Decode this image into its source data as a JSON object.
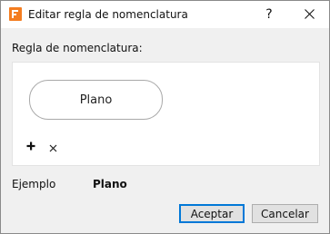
{
  "window": {
    "title": "Editar regla de nomenclatura",
    "help_label": "?",
    "app_icon": "F-app-icon",
    "icons": {
      "app": "F-app-icon",
      "close": "close-icon",
      "add": "plus-icon",
      "remove": "x-icon"
    },
    "colors": {
      "app_icon": "#f47d20",
      "accent": "#0078d7"
    }
  },
  "rule": {
    "label": "Regla de nomenclatura:",
    "tokens": [
      "Plano"
    ]
  },
  "example": {
    "label": "Ejemplo",
    "value": "Plano"
  },
  "buttons": {
    "accept": "Aceptar",
    "cancel": "Cancelar"
  }
}
